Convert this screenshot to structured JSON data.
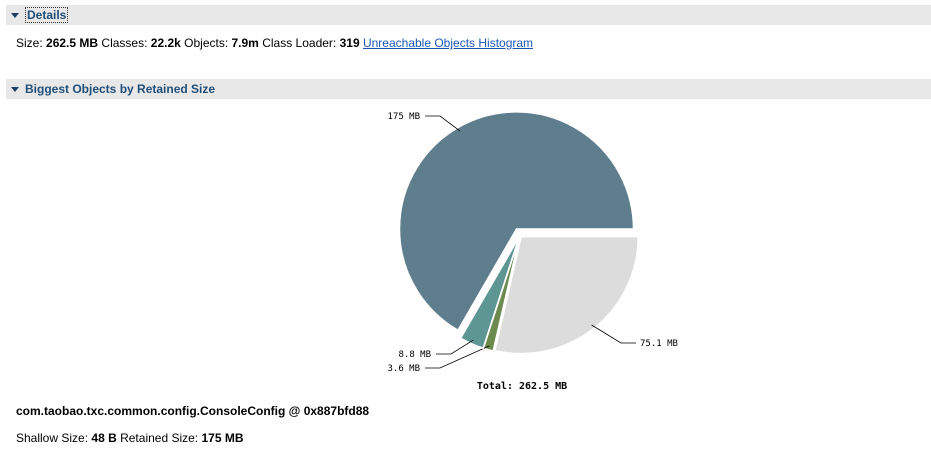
{
  "details": {
    "header": "Details",
    "size_label": "Size:",
    "size_value": "262.5 MB",
    "classes_label": "Classes:",
    "classes_value": "22.2k",
    "objects_label": "Objects:",
    "objects_value": "7.9m",
    "loader_label": "Class Loader:",
    "loader_value": "319",
    "histogram_link": "Unreachable Objects Histogram"
  },
  "biggest": {
    "header": "Biggest Objects by Retained Size"
  },
  "chart_data": {
    "type": "pie",
    "slices": [
      {
        "label": "175 MB",
        "value": 175,
        "color": "#5f7e8d"
      },
      {
        "label": "75.1 MB",
        "value": 75.1,
        "color": "#dcdcdc"
      },
      {
        "label": "3.6 MB",
        "value": 3.6,
        "color": "#6d8a4e"
      },
      {
        "label": "8.8 MB",
        "value": 8.8,
        "color": "#5e9694"
      }
    ],
    "total_label": "Total: 262.5 MB"
  },
  "selected_object": {
    "name": "com.taobao.txc.common.config.ConsoleConfig @ 0x887bfd88",
    "shallow_label": "Shallow Size:",
    "shallow_value": "48 B",
    "retained_label": "Retained Size:",
    "retained_value": "175 MB"
  }
}
